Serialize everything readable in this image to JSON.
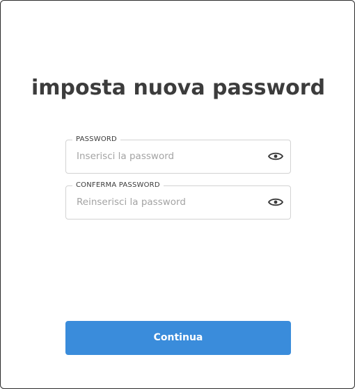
{
  "page": {
    "title": "imposta nuova password"
  },
  "form": {
    "password": {
      "label": "PASSWORD",
      "placeholder": "Inserisci la password",
      "value": "",
      "toggle_icon": "eye-icon"
    },
    "confirm_password": {
      "label": "CONFERMA PASSWORD",
      "placeholder": "Reinserisci la password",
      "value": "",
      "toggle_icon": "eye-icon"
    },
    "submit_label": "Continua"
  },
  "colors": {
    "primary": "#3a8cdb",
    "title_text": "#3c3c3c",
    "field_border": "#d2d2d2",
    "placeholder": "#a3a3a3"
  }
}
